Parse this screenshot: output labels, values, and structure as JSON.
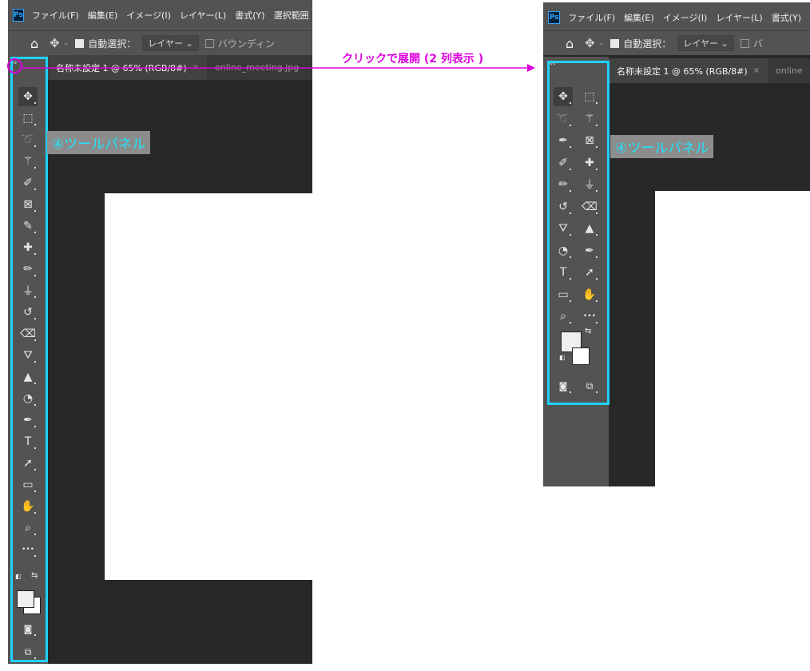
{
  "menu": {
    "logo": "Ps",
    "items": [
      "ファイル(F)",
      "編集(E)",
      "イメージ(I)",
      "レイヤー(L)",
      "書式(Y)",
      "選択範囲"
    ]
  },
  "options": {
    "auto_select_label": "自動選択：",
    "target_dropdown": "レイヤー",
    "bounding_label": "バウンディン",
    "bounding_label_short": "バ"
  },
  "tabs": [
    {
      "label": "名称未設定 1 @ 65% (RGB/8#)",
      "close": "×"
    },
    {
      "label": "online_meeting.jpg",
      "close": ""
    }
  ],
  "tabs_right_second": "online",
  "toolbar": {
    "expand_icon_text": "››",
    "collapse_icon_text": "‹‹",
    "tools_single_column": [
      "move-tool",
      "marquee-tool",
      "lasso-tool",
      "magic-wand-tool",
      "eyedropper-tool",
      "frame-tool",
      "color-sampler-tool",
      "healing-brush-tool",
      "brush-tool",
      "stamp-tool",
      "history-brush-tool",
      "eraser-tool",
      "paint-bucket-tool",
      "sharpen-tool",
      "dodge-tool",
      "pen-tool",
      "type-tool",
      "path-select-tool",
      "rectangle-tool",
      "hand-tool",
      "zoom-tool",
      "more-tools"
    ]
  },
  "colors": {
    "foreground": "#efefef",
    "background": "#ffffff",
    "highlight": "#1fd2ff",
    "annotation": "#dd00dd"
  },
  "annotation": {
    "panel_label": "④ツールパネル",
    "action_text": "クリックで展開 (2 列表示 )"
  }
}
